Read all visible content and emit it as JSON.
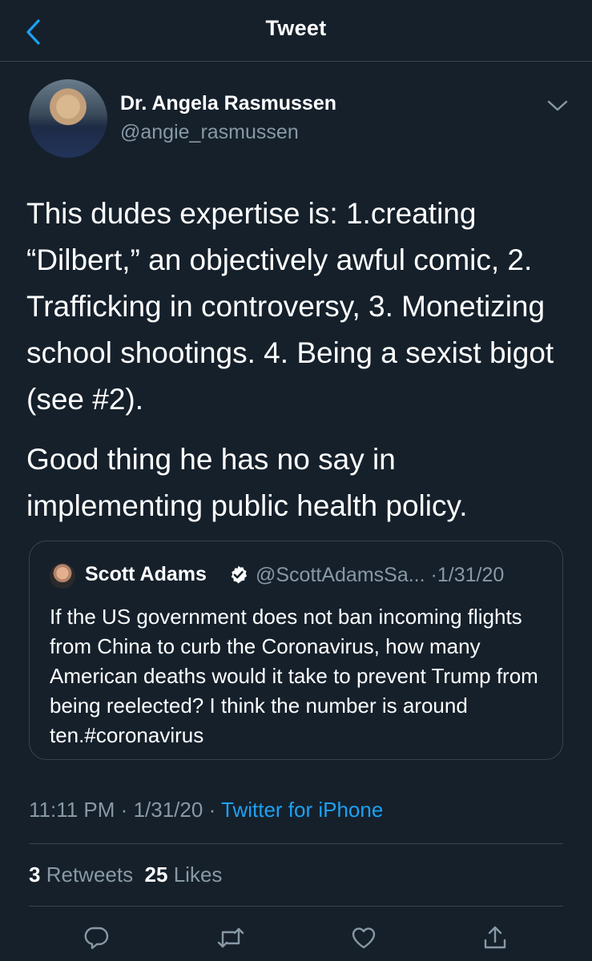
{
  "header": {
    "title": "Tweet"
  },
  "tweet": {
    "author_name": "Dr. Angela Rasmussen",
    "author_handle": "@angie_rasmussen",
    "paragraphs": [
      "This dudes expertise is: 1.creating “Dilbert,” an objectively awful comic, 2. Trafficking in controversy, 3. Monetizing school shootings. 4. Being a sexist bigot (see #2).",
      "Good thing he has no say in implementing public health policy."
    ],
    "time": "11:11 PM",
    "date": "1/31/20",
    "source": "Twitter for iPhone",
    "retweets_count": "3",
    "retweets_label": "Retweets",
    "likes_count": "25",
    "likes_label": "Likes"
  },
  "quoted": {
    "author_name": "Scott Adams",
    "author_handle": "@ScottAdamsSa...",
    "date": "1/31/20",
    "text": "If the US government does not ban incoming flights from China to curb the Coronavirus, how many American deaths would it take to prevent Trump from being reelected? I think the number is around ten.#coronavirus"
  },
  "meta_separator": "·",
  "icons": {
    "back": "chevron-left-icon",
    "menu": "chevron-down-icon",
    "verified": "verified-badge-icon",
    "reply": "reply-icon",
    "retweet": "retweet-icon",
    "like": "heart-icon",
    "share": "share-icon"
  },
  "colors": {
    "background": "#15202b",
    "border": "#38444d",
    "secondary_text": "#8899a6",
    "accent": "#1da1f2"
  }
}
